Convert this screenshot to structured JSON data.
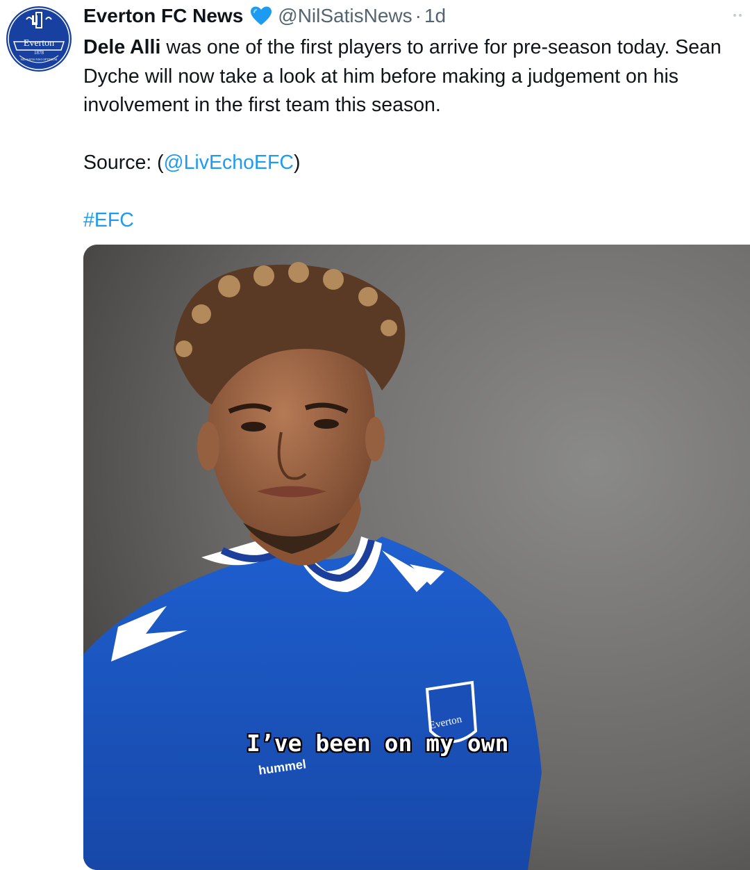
{
  "tweet": {
    "author": {
      "display_name": "Everton FC News",
      "verified_icon": "blue-heart-icon",
      "handle": "@NilSatisNews",
      "separator": "·",
      "time": "1d",
      "avatar": {
        "badge_name": "Everton",
        "badge_year": "1878",
        "motto": "NIL SATIS NISI OPTIMUM"
      }
    },
    "text": {
      "line1_bold": "Dele Alli",
      "line1_rest": " was one of the first players to arrive for pre-season today. Sean Dyche will now take a look at him before making a judgement on his involvement in the first team this season.",
      "source_prefix": "Source: (",
      "source_link": "@LivEchoEFC",
      "source_suffix": ")",
      "hashtag": "#EFC"
    },
    "media": {
      "caption": "I’ve been on my own",
      "shirt_brand": "hummel",
      "crest_text": "Everton"
    },
    "more_icon": "more-dots-icon"
  },
  "colors": {
    "link": "#1d9bf0",
    "secondary": "#536471",
    "everton_blue": "#1b4fb8",
    "heart": "#1d9bf0"
  }
}
